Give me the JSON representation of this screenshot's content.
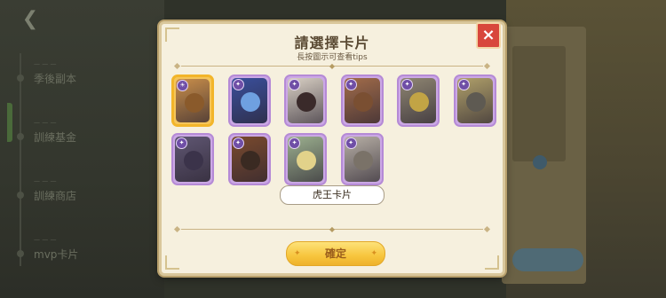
{
  "background": {
    "nav": [
      {
        "small": "— — —",
        "label": "季後副本"
      },
      {
        "small": "— — —",
        "label": "訓練基金"
      },
      {
        "small": "— — —",
        "label": "訓練商店"
      },
      {
        "small": "— — —",
        "label": "mvp卡片"
      }
    ]
  },
  "dialog": {
    "title": "請選擇卡片",
    "subtitle": "長按圖示可查看tips",
    "close_icon": "×",
    "selected_card": "虎王卡片",
    "confirm_label": "確定",
    "cards": [
      {
        "art": "#c98e4a",
        "face": "#8a5a2b",
        "icon": "☀",
        "selected": true
      },
      {
        "art": "#3a4f9c",
        "face": "#6fa0e0",
        "icon": "✦",
        "selected": false
      },
      {
        "art": "#d9d0c4",
        "face": "#3a2a2a",
        "icon": "✦",
        "selected": false
      },
      {
        "art": "#a26c4a",
        "face": "#7a4f32",
        "icon": "✦",
        "selected": false
      },
      {
        "art": "#8f8672",
        "face": "#c2a445",
        "icon": "✦",
        "selected": false
      },
      {
        "art": "#b0a06a",
        "face": "#5e5a52",
        "icon": "✦",
        "selected": false
      },
      {
        "art": "#5f5672",
        "face": "#3b334a",
        "icon": "✦",
        "selected": false
      },
      {
        "art": "#7a4a2e",
        "face": "#3a2a22",
        "icon": "✦",
        "selected": false
      },
      {
        "art": "#9cb08f",
        "face": "#e2d28a",
        "icon": "✦",
        "selected": false
      },
      {
        "art": "#b7afa5",
        "face": "#7a7268",
        "icon": "✦",
        "selected": false
      }
    ]
  }
}
